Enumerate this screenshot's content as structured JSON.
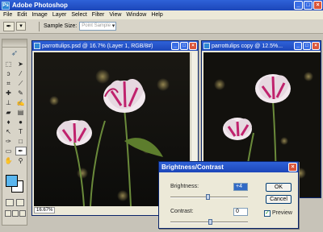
{
  "app": {
    "title": "Adobe Photoshop"
  },
  "menu": [
    "File",
    "Edit",
    "Image",
    "Layer",
    "Select",
    "Filter",
    "View",
    "Window",
    "Help"
  ],
  "options_bar": {
    "tool_icon": "eyedropper-icon",
    "sample_size_label": "Sample Size:",
    "sample_size_value": "Point Sample"
  },
  "toolbox": {
    "tools": [
      "marquee-icon",
      "move-icon",
      "lasso-icon",
      "magic-wand-icon",
      "crop-icon",
      "slice-icon",
      "healing-brush-icon",
      "brush-icon",
      "clone-stamp-icon",
      "history-brush-icon",
      "eraser-icon",
      "gradient-icon",
      "blur-icon",
      "dodge-icon",
      "path-select-icon",
      "type-icon",
      "pen-icon",
      "shape-icon",
      "notes-icon",
      "eyedropper-icon",
      "hand-icon",
      "zoom-icon"
    ],
    "active_tool": "eyedropper-icon",
    "foreground_color": "#5ab6ee",
    "background_color": "#ffffff"
  },
  "doc1": {
    "title": "parrottulips.psd @ 16.7% (Layer 1, RGB/8#)",
    "zoom": "16.67%"
  },
  "doc2": {
    "title": "parrottulips copy @ 12.5%..."
  },
  "dialog": {
    "title": "Brightness/Contrast",
    "brightness_label": "Brightness:",
    "brightness_value": "+4",
    "contrast_label": "Contrast:",
    "contrast_value": "0",
    "ok_label": "OK",
    "cancel_label": "Cancel",
    "preview_label": "Preview",
    "preview_checked": true
  }
}
